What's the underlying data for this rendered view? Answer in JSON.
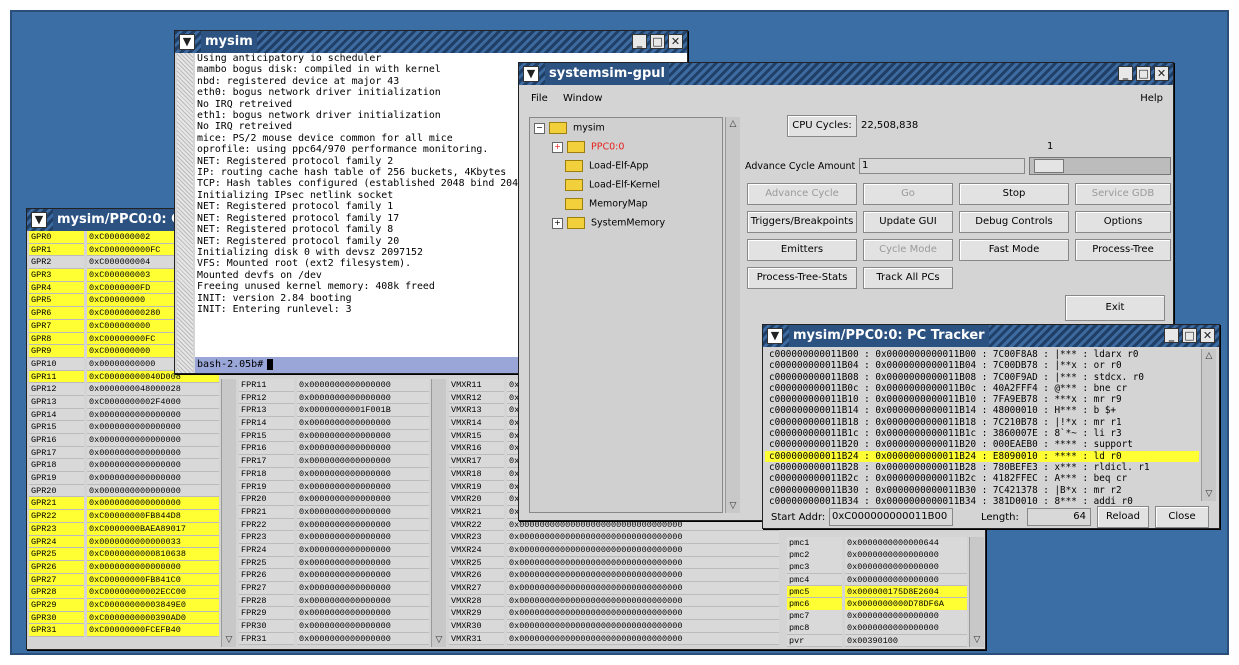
{
  "colors": {
    "desktop": "#3a6ea5",
    "highlight": "#ffff33",
    "prompt_bg": "#9aa6d8",
    "ppc_red": "#e8201c"
  },
  "regs_window": {
    "title": "mysim/PPC0:0: Co",
    "gpr": [
      {
        "name": "GPR0",
        "value": "0xC000000002",
        "hl": true
      },
      {
        "name": "GPR1",
        "value": "0xC000000000FC",
        "hl": true
      },
      {
        "name": "GPR2",
        "value": "0xC000000004",
        "hl": false
      },
      {
        "name": "GPR3",
        "value": "0xC000000003",
        "hl": true
      },
      {
        "name": "GPR4",
        "value": "0xC0000000FD",
        "hl": true
      },
      {
        "name": "GPR5",
        "value": "0xC00000000",
        "hl": true
      },
      {
        "name": "GPR6",
        "value": "0xC00000000280",
        "hl": true
      },
      {
        "name": "GPR7",
        "value": "0xC000000000",
        "hl": true
      },
      {
        "name": "GPR8",
        "value": "0xC00000000FC",
        "hl": true
      },
      {
        "name": "GPR9",
        "value": "0xC000000000",
        "hl": true
      },
      {
        "name": "GPR10",
        "value": "0x00000000000",
        "hl": false
      },
      {
        "name": "GPR11",
        "value": "0xC00000000040D008",
        "hl": true
      },
      {
        "name": "GPR12",
        "value": "0x0000000048000028",
        "hl": false
      },
      {
        "name": "GPR13",
        "value": "0xC0000000002F4000",
        "hl": false
      },
      {
        "name": "GPR14",
        "value": "0x0000000000000000",
        "hl": false
      },
      {
        "name": "GPR15",
        "value": "0x0000000000000000",
        "hl": false
      },
      {
        "name": "GPR16",
        "value": "0x0000000000000000",
        "hl": false
      },
      {
        "name": "GPR17",
        "value": "0x0000000000000000",
        "hl": false
      },
      {
        "name": "GPR18",
        "value": "0x0000000000000000",
        "hl": false
      },
      {
        "name": "GPR19",
        "value": "0x0000000000000000",
        "hl": false
      },
      {
        "name": "GPR20",
        "value": "0x0000000000000000",
        "hl": false
      },
      {
        "name": "GPR21",
        "value": "0x0000000000000000",
        "hl": true
      },
      {
        "name": "GPR22",
        "value": "0xC00000000FB844D8",
        "hl": true
      },
      {
        "name": "GPR23",
        "value": "0xC0000000BAEA89017",
        "hl": true
      },
      {
        "name": "GPR24",
        "value": "0x0000000000000033",
        "hl": true
      },
      {
        "name": "GPR25",
        "value": "0xC0000000000810638",
        "hl": true
      },
      {
        "name": "GPR26",
        "value": "0x0000000000000000",
        "hl": true
      },
      {
        "name": "GPR27",
        "value": "0xC00000000FB841C0",
        "hl": true
      },
      {
        "name": "GPR28",
        "value": "0xC00000000002ECC00",
        "hl": true
      },
      {
        "name": "GPR29",
        "value": "0xC00000000003849E0",
        "hl": true
      },
      {
        "name": "GPR30",
        "value": "0xC0000000000390AD0",
        "hl": true
      },
      {
        "name": "GPR31",
        "value": "0xC00000000FCEFB40",
        "hl": true
      }
    ],
    "fpr": [
      {
        "name": "FPR11",
        "value": "0x0000000000000000"
      },
      {
        "name": "FPR12",
        "value": "0x0000000000000000"
      },
      {
        "name": "FPR13",
        "value": "0x00000000001F001B"
      },
      {
        "name": "FPR14",
        "value": "0x0000000000000000"
      },
      {
        "name": "FPR15",
        "value": "0x0000000000000000"
      },
      {
        "name": "FPR16",
        "value": "0x0000000000000000"
      },
      {
        "name": "FPR17",
        "value": "0x0000000000000000"
      },
      {
        "name": "FPR18",
        "value": "0x0000000000000000"
      },
      {
        "name": "FPR19",
        "value": "0x0000000000000000"
      },
      {
        "name": "FPR20",
        "value": "0x0000000000000000"
      },
      {
        "name": "FPR21",
        "value": "0x0000000000000000"
      },
      {
        "name": "FPR22",
        "value": "0x0000000000000000"
      },
      {
        "name": "FPR23",
        "value": "0x0000000000000000"
      },
      {
        "name": "FPR24",
        "value": "0x0000000000000000"
      },
      {
        "name": "FPR25",
        "value": "0x0000000000000000"
      },
      {
        "name": "FPR26",
        "value": "0x0000000000000000"
      },
      {
        "name": "FPR27",
        "value": "0x0000000000000000"
      },
      {
        "name": "FPR28",
        "value": "0x0000000000000000"
      },
      {
        "name": "FPR29",
        "value": "0x0000000000000000"
      },
      {
        "name": "FPR30",
        "value": "0x0000000000000000"
      },
      {
        "name": "FPR31",
        "value": "0x0000000000000000"
      }
    ],
    "vmx": [
      {
        "name": "VMXR11",
        "value": "0x"
      },
      {
        "name": "VMXR12",
        "value": "0x"
      },
      {
        "name": "VMXR13",
        "value": "0x"
      },
      {
        "name": "VMXR14",
        "value": "0x"
      },
      {
        "name": "VMXR15",
        "value": "0x"
      },
      {
        "name": "VMXR16",
        "value": "0x"
      },
      {
        "name": "VMXR17",
        "value": "0x"
      },
      {
        "name": "VMXR18",
        "value": "0x"
      },
      {
        "name": "VMXR19",
        "value": "0x"
      },
      {
        "name": "VMXR20",
        "value": "0x"
      },
      {
        "name": "VMXR21",
        "value": "0x"
      },
      {
        "name": "VMXR22",
        "value": "0x00000000000000000000000000000000"
      },
      {
        "name": "VMXR23",
        "value": "0x00000000000000000000000000000000"
      },
      {
        "name": "VMXR24",
        "value": "0x00000000000000000000000000000000"
      },
      {
        "name": "VMXR25",
        "value": "0x00000000000000000000000000000000"
      },
      {
        "name": "VMXR26",
        "value": "0x00000000000000000000000000000000"
      },
      {
        "name": "VMXR27",
        "value": "0x00000000000000000000000000000000"
      },
      {
        "name": "VMXR28",
        "value": "0x00000000000000000000000000000000"
      },
      {
        "name": "VMXR29",
        "value": "0x00000000000000000000000000000000"
      },
      {
        "name": "VMXR30",
        "value": "0x00000000000000000000000000000000"
      },
      {
        "name": "VMXR31",
        "value": "0x00000000000000000000000000000000"
      }
    ],
    "pmc": [
      {
        "name": "pmc1",
        "value": "0x0000000000000644",
        "hl": false
      },
      {
        "name": "pmc2",
        "value": "0x0000000000000000",
        "hl": false
      },
      {
        "name": "pmc3",
        "value": "0x0000000000000000",
        "hl": false
      },
      {
        "name": "pmc4",
        "value": "0x0000000000000000",
        "hl": false
      },
      {
        "name": "pmc5",
        "value": "0x000000175D8E2604",
        "hl": true
      },
      {
        "name": "pmc6",
        "value": "0x0000000000D78DF6A",
        "hl": true
      },
      {
        "name": "pmc7",
        "value": "0x0000000000000000",
        "hl": false
      },
      {
        "name": "pmc8",
        "value": "0x0000000000000000",
        "hl": false
      },
      {
        "name": "pvr",
        "value": "0x00390100",
        "hl": false
      }
    ]
  },
  "terminal": {
    "title": "mysim",
    "lines": [
      "Using anticipatory io scheduler",
      "mambo bogus disk: compiled in with kernel",
      "nbd: registered device at major 43",
      "eth0: bogus network driver initialization",
      "No IRQ retreived",
      "eth1: bogus network driver initialization",
      "No IRQ retreived",
      "mice: PS/2 mouse device common for all mice",
      "oprofile: using ppc64/970 performance monitoring.",
      "NET: Registered protocol family 2",
      "IP: routing cache hash table of 256 buckets, 4Kbytes",
      "TCP: Hash tables configured (established 2048 bind 204",
      "Initializing IPsec netlink socket",
      "NET: Registered protocol family 1",
      "NET: Registered protocol family 17",
      "NET: Registered protocol family 8",
      "NET: Registered protocol family 20",
      "Initializing disk 0 with devsz 2097152",
      "VFS: Mounted root (ext2 filesystem).",
      "Mounted devfs on /dev",
      "Freeing unused kernel memory: 408k freed",
      "INIT: version 2.84 booting",
      "INIT: Entering runlevel: 3"
    ],
    "prompt": "bash-2.05b#"
  },
  "gpul": {
    "title": "systemsim-gpul",
    "menu": {
      "file": "File",
      "window": "Window",
      "help": "Help"
    },
    "tree": {
      "root": "mysim",
      "items": [
        "PPC0:0",
        "Load-Elf-App",
        "Load-Elf-Kernel",
        "MemoryMap",
        "SystemMemory"
      ]
    },
    "cpu_cycles_label": "CPU Cycles:",
    "cpu_cycles_value": "22,508,838",
    "advance_label": "Advance Cycle Amount :",
    "advance_value": "1",
    "slider_value": "1",
    "buttons": {
      "advance_cycle": "Advance Cycle",
      "go": "Go",
      "stop": "Stop",
      "service_gdb": "Service GDB",
      "triggers": "Triggers/Breakpoints",
      "update_gui": "Update GUI",
      "debug_controls": "Debug Controls",
      "options": "Options",
      "emitters": "Emitters",
      "cycle_mode": "Cycle Mode",
      "fast_mode": "Fast Mode",
      "process_tree": "Process-Tree",
      "process_tree_stats": "Process-Tree-Stats",
      "track_all_pcs": "Track All PCs",
      "exit": "Exit"
    }
  },
  "pc_tracker": {
    "title": "mysim/PPC0:0: PC Tracker",
    "lines": [
      "c000000000011B00 : 0x0000000000011B00 : 7C00F8A8 : |*** : ldarx   r0",
      "c000000000011B04 : 0x0000000000011B04 : 7C00DB78 : |**x : or      r0",
      "c000000000011B08 : 0x0000000000011B08 : 7C00F9AD : |*** : stdcx.  r0",
      "c000000000011B0c : 0x0000000000011B0c : 40A2FFF4 : @*** : bne     cr",
      "c000000000011B10 : 0x0000000000011B10 : 7FA9EB78 : ***x : mr      r9",
      "c000000000011B14 : 0x0000000000011B14 : 48000010 : H*** : b       $+",
      "c000000000011B18 : 0x0000000000011B18 : 7C210B78 : |!*x : mr      r1",
      "c000000000011B1c : 0x0000000000011B1c : 3860007E : 8`*~ : li      r3",
      "c000000000011B20 : 0x0000000000011B20 : 000EAEB0 : **** : support",
      "c000000000011B24 : 0x0000000000011B24 : E8090010 : **** : ld      r0",
      "c000000000011B28 : 0x0000000000011B28 : 780BEFE3 : x*** : rldicl. r1",
      "c000000000011B2c : 0x0000000000011B2c : 4182FFEC : A*** : beq     cr",
      "c000000000011B30 : 0x0000000000011B30 : 7C421378 : |B*x : mr      r2",
      "c000000000011B34 : 0x0000000000011B34 : 381D0010 : 8*** : addi    r0"
    ],
    "selected_index": 9,
    "start_addr_label": "Start Addr:",
    "start_addr_value": "0xC000000000011B00",
    "length_label": "Length:",
    "length_value": "64",
    "reload": "Reload",
    "close": "Close"
  }
}
